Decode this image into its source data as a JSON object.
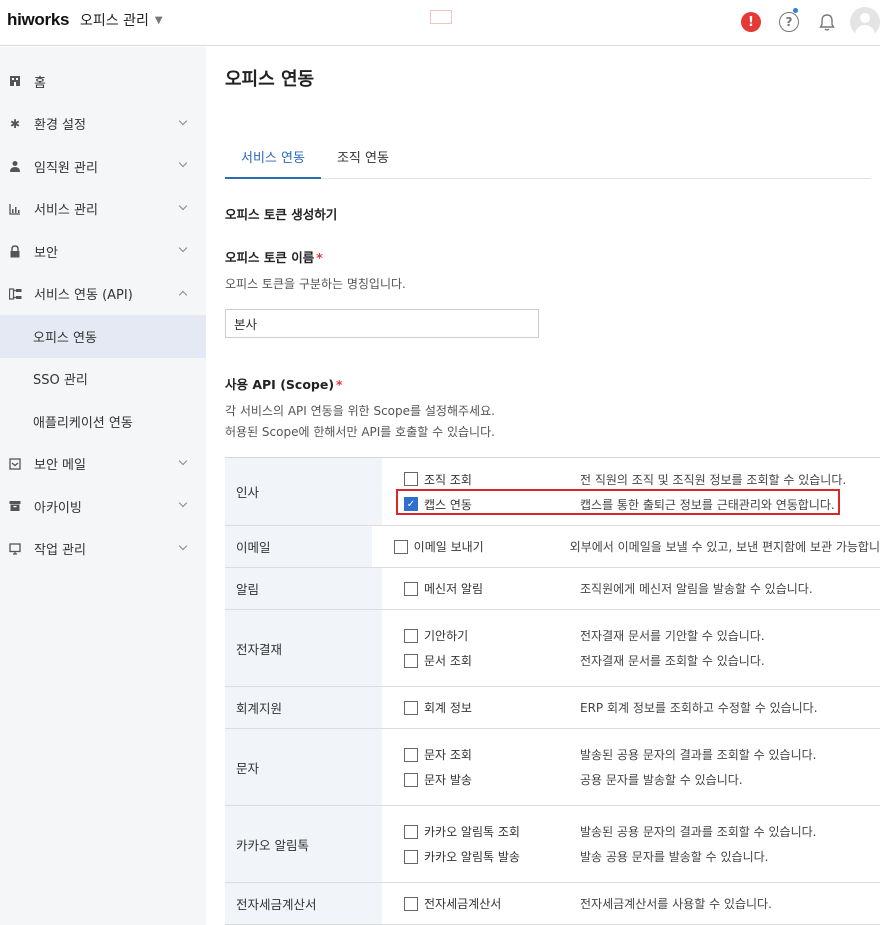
{
  "topbar": {
    "logo": "hiworks",
    "office_menu": "오피스 관리",
    "icons": [
      "alert-icon",
      "help-icon",
      "bell-icon",
      "user-avatar"
    ]
  },
  "sidebar": {
    "items": [
      {
        "label": "홈",
        "icon": "home-icon"
      },
      {
        "label": "환경 설정",
        "icon": "gear-icon"
      },
      {
        "label": "임직원 관리",
        "icon": "person-icon"
      },
      {
        "label": "서비스 관리",
        "icon": "chart-icon"
      },
      {
        "label": "보안",
        "icon": "lock-icon"
      },
      {
        "label": "서비스 연동 (API)",
        "icon": "integration-icon"
      },
      {
        "label": "오피스 연동"
      },
      {
        "label": "SSO 관리"
      },
      {
        "label": "애플리케이션 연동"
      },
      {
        "label": "보안 메일",
        "icon": "mail-icon"
      },
      {
        "label": "아카이빙",
        "icon": "archive-icon"
      },
      {
        "label": "작업 관리",
        "icon": "monitor-icon"
      }
    ]
  },
  "main": {
    "title": "오피스 연동",
    "tabs": [
      {
        "label": "서비스 연동"
      },
      {
        "label": "조직 연동"
      }
    ],
    "section_title": "오피스 토큰 생성하기",
    "token_label": "오피스 토큰 이름",
    "required_mark": "*",
    "token_desc": "오피스 토큰을 구분하는 명칭입니다.",
    "token_value": "본사",
    "scope_label": "사용 API (Scope)",
    "scope_desc_1": "각 서비스의 API 연동을 위한 Scope를 설정해주세요.",
    "scope_desc_2": "허용된 Scope에 한해서만 API를 호출할 수 있습니다."
  },
  "scopes": [
    {
      "category": "인사",
      "items": [
        {
          "name": "조직 조회",
          "desc": "전 직원의 조직 및 조직원 정보를 조회할 수 있습니다.",
          "checked": false
        },
        {
          "name": "캡스 연동",
          "desc": "캡스를 통한 출퇴근 정보를 근태관리와 연동합니다.",
          "checked": true
        }
      ]
    },
    {
      "category": "이메일",
      "items": [
        {
          "name": "이메일 보내기",
          "desc": "외부에서 이메일을 보낼 수 있고, 보낸 편지함에 보관 가능합니",
          "checked": false
        }
      ]
    },
    {
      "category": "알림",
      "items": [
        {
          "name": "메신저 알림",
          "desc": "조직원에게 메신저 알림을 발송할 수 있습니다.",
          "checked": false
        }
      ]
    },
    {
      "category": "전자결재",
      "items": [
        {
          "name": "기안하기",
          "desc": "전자결재 문서를 기안할 수 있습니다.",
          "checked": false
        },
        {
          "name": "문서 조회",
          "desc": "전자결재 문서를 조회할 수 있습니다.",
          "checked": false
        }
      ]
    },
    {
      "category": "회계지원",
      "items": [
        {
          "name": "회계 정보",
          "desc": "ERP 회계 정보를 조회하고 수정할 수 있습니다.",
          "checked": false
        }
      ]
    },
    {
      "category": "문자",
      "items": [
        {
          "name": "문자 조회",
          "desc": "발송된 공용 문자의 결과를 조회할 수 있습니다.",
          "checked": false
        },
        {
          "name": "문자 발송",
          "desc": "공용 문자를 발송할 수 있습니다.",
          "checked": false
        }
      ]
    },
    {
      "category": "카카오 알림톡",
      "items": [
        {
          "name": "카카오 알림톡 조회",
          "desc": "발송된 공용 문자의 결과를 조회할 수 있습니다.",
          "checked": false
        },
        {
          "name": "카카오 알림톡 발송",
          "desc": "발송 공용 문자를 발송할 수 있습니다.",
          "checked": false
        }
      ]
    },
    {
      "category": "전자세금계산서",
      "items": [
        {
          "name": "전자세금계산서",
          "desc": "전자세금계산서를 사용할 수 있습니다.",
          "checked": false
        }
      ]
    }
  ],
  "colors": {
    "accent": "#2c6bb8",
    "required": "#e53935",
    "highlight": "#d9272e",
    "sidebar_bg": "#f5f6f8",
    "active_item_bg": "#e4e9f3"
  }
}
